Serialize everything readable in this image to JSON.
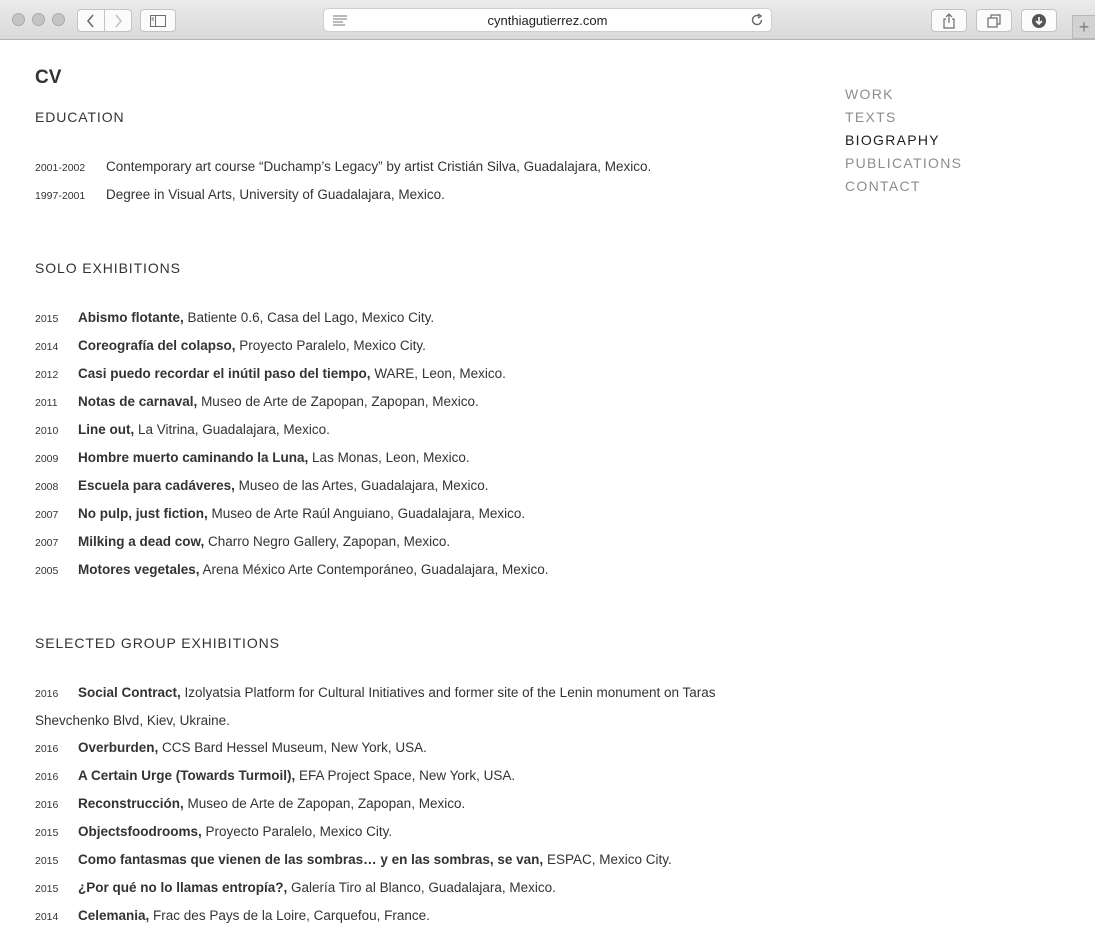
{
  "browser": {
    "url": "cynthiagutierrez.com"
  },
  "nav": [
    {
      "label": "WORK",
      "active": false
    },
    {
      "label": "TEXTS",
      "active": false
    },
    {
      "label": "BIOGRAPHY",
      "active": true
    },
    {
      "label": "PUBLICATIONS",
      "active": false
    },
    {
      "label": "CONTACT",
      "active": false
    }
  ],
  "page_title": "CV",
  "education": {
    "heading": "EDUCATION",
    "items": [
      {
        "year": "2001-2002",
        "text": "Contemporary art course “Duchamp’s Legacy” by artist Cristián Silva, Guadalajara, Mexico."
      },
      {
        "year": "1997-2001",
        "text": "Degree in Visual Arts, University of Guadalajara, Mexico."
      }
    ]
  },
  "solo_exhibitions": {
    "heading": "SOLO EXHIBITIONS",
    "items": [
      {
        "year": "2015",
        "title": "Abismo flotante,",
        "details": " Batiente 0.6, Casa del Lago, Mexico City."
      },
      {
        "year": "2014",
        "title": "Coreografía del colapso,",
        "details": " Proyecto Paralelo, Mexico City."
      },
      {
        "year": "2012",
        "title": "Casi puedo recordar el inútil paso del tiempo,",
        "details": " WARE, Leon, Mexico."
      },
      {
        "year": "2011",
        "title": "Notas de carnaval,",
        "details": " Museo de Arte de Zapopan, Zapopan, Mexico."
      },
      {
        "year": "2010",
        "title": "Line out,",
        "details": " La Vitrina, Guadalajara, Mexico."
      },
      {
        "year": "2009",
        "title": "Hombre muerto caminando la Luna,",
        "details": " Las Monas, Leon, Mexico."
      },
      {
        "year": "2008",
        "title": "Escuela para cadáveres,",
        "details": " Museo de las Artes, Guadalajara, Mexico."
      },
      {
        "year": "2007",
        "title": "No pulp, just fiction,",
        "details": " Museo de Arte Raúl Anguiano, Guadalajara, Mexico."
      },
      {
        "year": "2007",
        "title": "Milking a dead cow,",
        "details": " Charro Negro Gallery, Zapopan, Mexico."
      },
      {
        "year": "2005",
        "title": "Motores vegetales,",
        "details": " Arena México Arte Contemporáneo, Guadalajara, Mexico."
      }
    ]
  },
  "group_exhibitions": {
    "heading": "SELECTED GROUP EXHIBITIONS",
    "items": [
      {
        "year": "2016",
        "title": "Social Contract,",
        "details": " Izolyatsia Platform for Cultural Initiatives and former site of the Lenin monument on Taras",
        "continuation": "Shevchenko Blvd, Kiev, Ukraine."
      },
      {
        "year": "2016",
        "title": "Overburden,",
        "details": " CCS Bard Hessel Museum, New York, USA."
      },
      {
        "year": "2016",
        "title": "A Certain Urge (Towards Turmoil),",
        "details": " EFA Project Space, New York, USA."
      },
      {
        "year": "2016",
        "title": "Reconstrucción,",
        "details": " Museo de Arte de Zapopan, Zapopan, Mexico."
      },
      {
        "year": "2015",
        "title": "Objectsfoodrooms,",
        "details": " Proyecto Paralelo, Mexico City."
      },
      {
        "year": "2015",
        "title": "Como fantasmas que vienen de las sombras… y en las sombras, se van,",
        "details": " ESPAC, Mexico City."
      },
      {
        "year": "2015",
        "title": "¿Por qué no lo llamas entropía?,",
        "details": " Galería Tiro al Blanco, Guadalajara, Mexico."
      },
      {
        "year": "2014",
        "title": "Celemania,",
        "details": " Frac des Pays de la Loire, Carquefou, France."
      }
    ]
  }
}
